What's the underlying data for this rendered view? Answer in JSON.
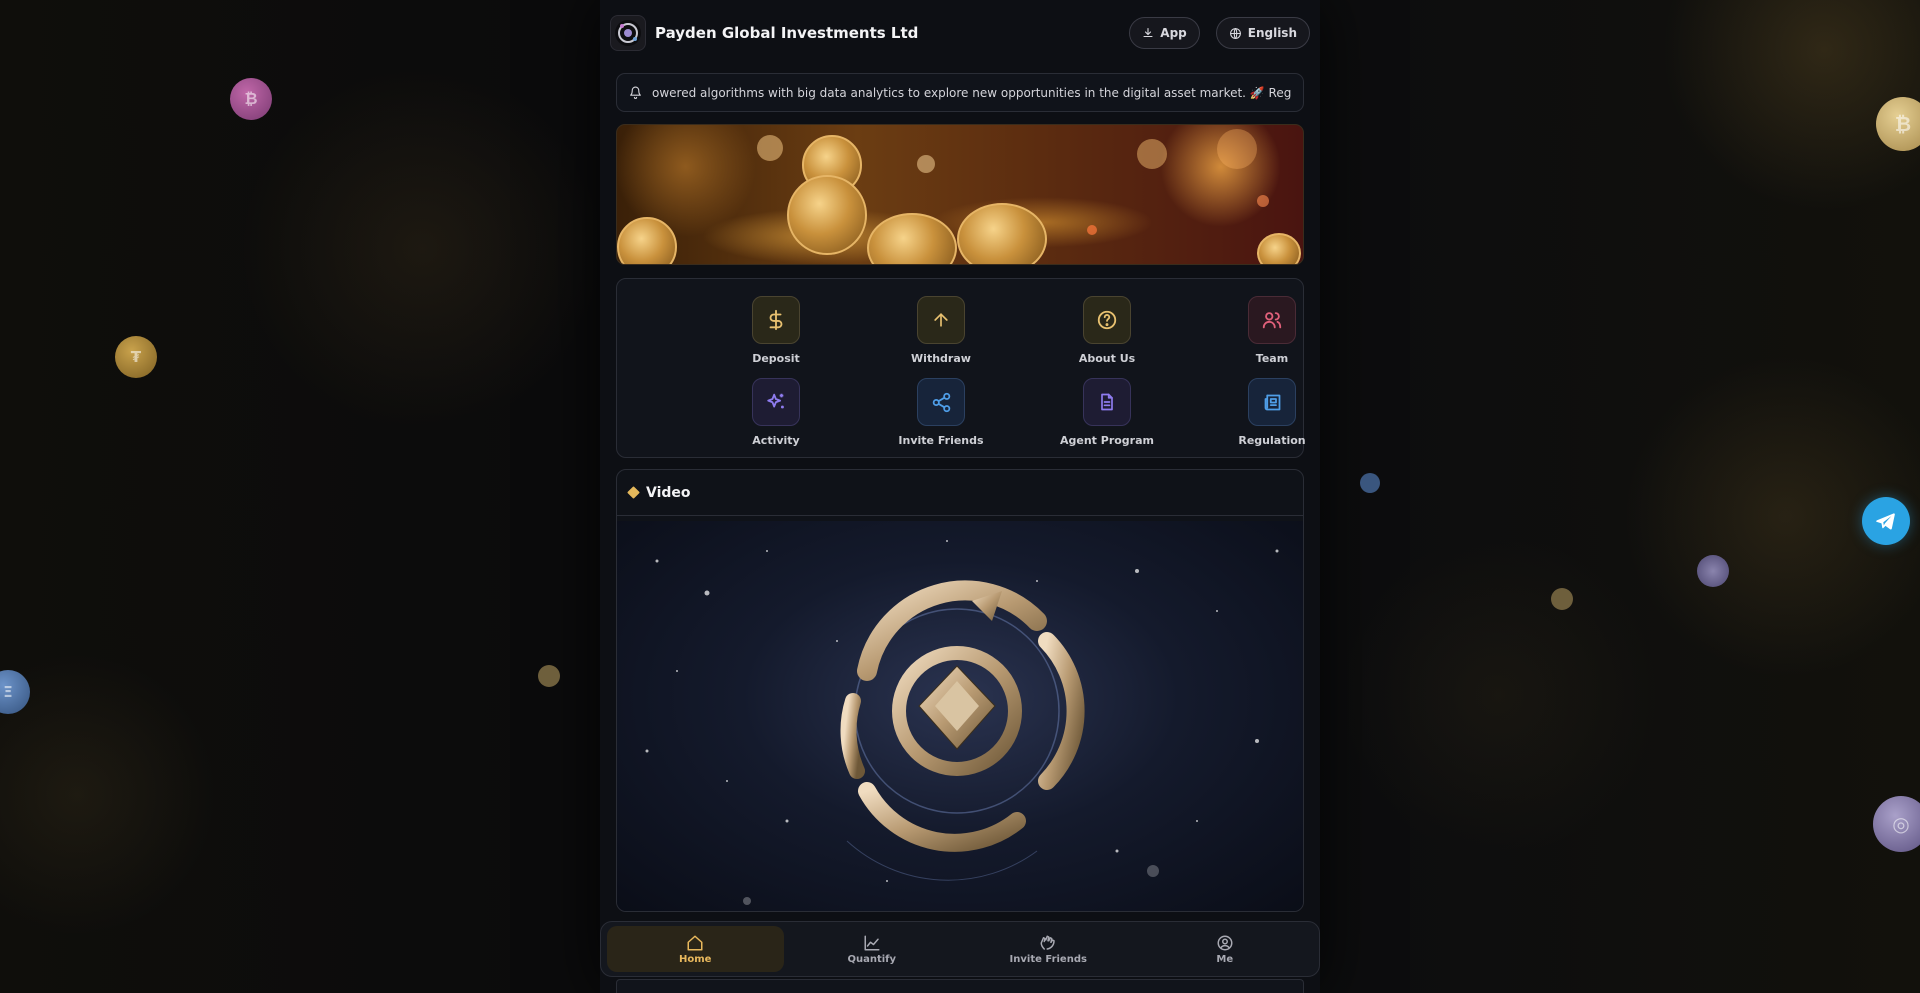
{
  "header": {
    "brand": "Payden Global Investments Ltd",
    "app_label": "App",
    "language_label": "English"
  },
  "notice": {
    "text": "owered algorithms with big data analytics to explore new opportunities in the digital asset market. 🚀 Register now and start you"
  },
  "menu": {
    "items": [
      {
        "label": "Deposit",
        "icon": "dollar-icon",
        "color": "#e8c170"
      },
      {
        "label": "Withdraw",
        "icon": "arrow-up-icon",
        "color": "#e8c170"
      },
      {
        "label": "About Us",
        "icon": "help-circle-icon",
        "color": "#e8c170"
      },
      {
        "label": "Team",
        "icon": "users-icon",
        "color": "#e0607a"
      },
      {
        "label": "Activity",
        "icon": "sparkles-icon",
        "color": "#8f7cf0"
      },
      {
        "label": "Invite Friends",
        "icon": "share-icon",
        "color": "#4f9ee8"
      },
      {
        "label": "Agent Program",
        "icon": "document-icon",
        "color": "#8f7cf0"
      },
      {
        "label": "Regulation",
        "icon": "newspaper-icon",
        "color": "#4f9ee8"
      }
    ]
  },
  "video": {
    "title": "Video"
  },
  "bottom_nav": {
    "items": [
      {
        "label": "Home",
        "icon": "home-icon",
        "active": true
      },
      {
        "label": "Quantify",
        "icon": "chart-line-icon",
        "active": false
      },
      {
        "label": "Invite Friends",
        "icon": "handshake-icon",
        "active": false
      },
      {
        "label": "Me",
        "icon": "user-circle-icon",
        "active": false
      }
    ]
  },
  "floating_coins": [
    {
      "symbol": "₿"
    },
    {
      "symbol": "₮"
    },
    {
      "symbol": "Ξ"
    },
    {
      "symbol": "₿"
    },
    {
      "symbol": "◎"
    }
  ],
  "colors": {
    "accent": "#e9b95d",
    "background": "#0b0b0d",
    "card": "#11141b",
    "telegram": "#2aa3e3"
  }
}
